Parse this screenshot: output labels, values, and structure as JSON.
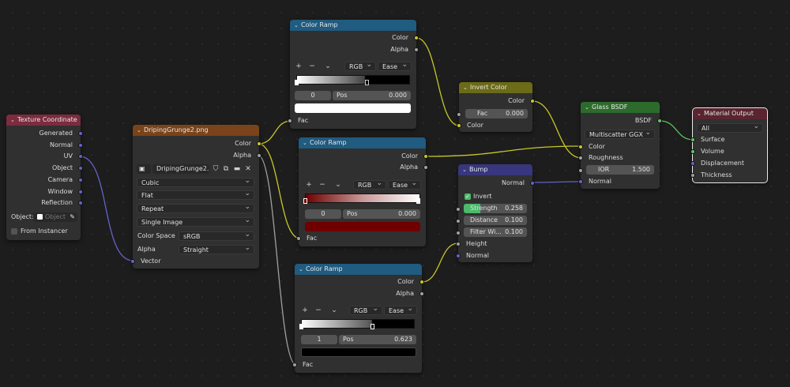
{
  "colors": {
    "texture_header": "#7b2c3f",
    "image_header": "#7a4319",
    "converter_header": "#205b80",
    "color_header": "#6b6b18",
    "vector_header": "#38367c",
    "shader_header": "#2d6b2d",
    "output_header": "#5a2530",
    "color_socket": "#c7c729",
    "float_socket": "#a1a1a1",
    "vector_socket": "#6363c7",
    "shader_socket": "#63c763",
    "checkbox_on": "#4cba6a"
  },
  "texture_coordinate": {
    "title": "Texture Coordinate",
    "outputs": [
      "Generated",
      "Normal",
      "UV",
      "Object",
      "Camera",
      "Window",
      "Reflection"
    ],
    "object_label": "Object:",
    "object_placeholder": "Object",
    "from_instancer": "From Instancer"
  },
  "image_texture": {
    "title": "DripingGrunge2.png",
    "outputs": [
      "Color",
      "Alpha"
    ],
    "image_name": "DripingGrunge2....",
    "interpolation": "Cubic",
    "projection": "Flat",
    "extension": "Repeat",
    "source": "Single Image",
    "color_space_label": "Color Space",
    "color_space": "sRGB",
    "alpha_label": "Alpha",
    "alpha": "Straight",
    "input": "Vector"
  },
  "ramp1": {
    "title": "Color Ramp",
    "outputs": [
      "Color",
      "Alpha"
    ],
    "color_mode": "RGB",
    "interpolation": "Ease",
    "plus": "+",
    "minus": "−",
    "stop_index": "0",
    "pos_label": "Pos",
    "pos_value": "0.000",
    "swatch": "#ffffff",
    "input": "Fac"
  },
  "ramp2": {
    "title": "Color Ramp",
    "outputs": [
      "Color",
      "Alpha"
    ],
    "color_mode": "RGB",
    "interpolation": "Ease",
    "plus": "+",
    "minus": "−",
    "stop_index": "0",
    "pos_label": "Pos",
    "pos_value": "0.000",
    "swatch": "#700000",
    "input": "Fac"
  },
  "ramp3": {
    "title": "Color Ramp",
    "outputs": [
      "Color",
      "Alpha"
    ],
    "color_mode": "RGB",
    "interpolation": "Ease",
    "plus": "+",
    "minus": "−",
    "stop_index": "1",
    "pos_label": "Pos",
    "pos_value": "0.623",
    "swatch": "#000000",
    "input": "Fac"
  },
  "invert_color": {
    "title": "Invert Color",
    "output": "Color",
    "fac_label": "Fac",
    "fac_value": "0.000",
    "input": "Color"
  },
  "bump": {
    "title": "Bump",
    "output": "Normal",
    "invert_label": "Invert",
    "strength_label": "Strength",
    "strength_value": "0.258",
    "distance_label": "Distance",
    "distance_value": "0.100",
    "filter_label": "Filter Wi...",
    "filter_value": "0.100",
    "inputs": [
      "Height",
      "Normal"
    ]
  },
  "glass_bsdf": {
    "title": "Glass BSDF",
    "output": "BSDF",
    "distribution": "Multiscatter GGX",
    "inputs": [
      "Color",
      "Roughness"
    ],
    "ior_label": "IOR",
    "ior_value": "1.500",
    "normal": "Normal"
  },
  "material_output": {
    "title": "Material Output",
    "target": "All",
    "inputs": [
      "Surface",
      "Volume",
      "Displacement",
      "Thickness"
    ]
  }
}
